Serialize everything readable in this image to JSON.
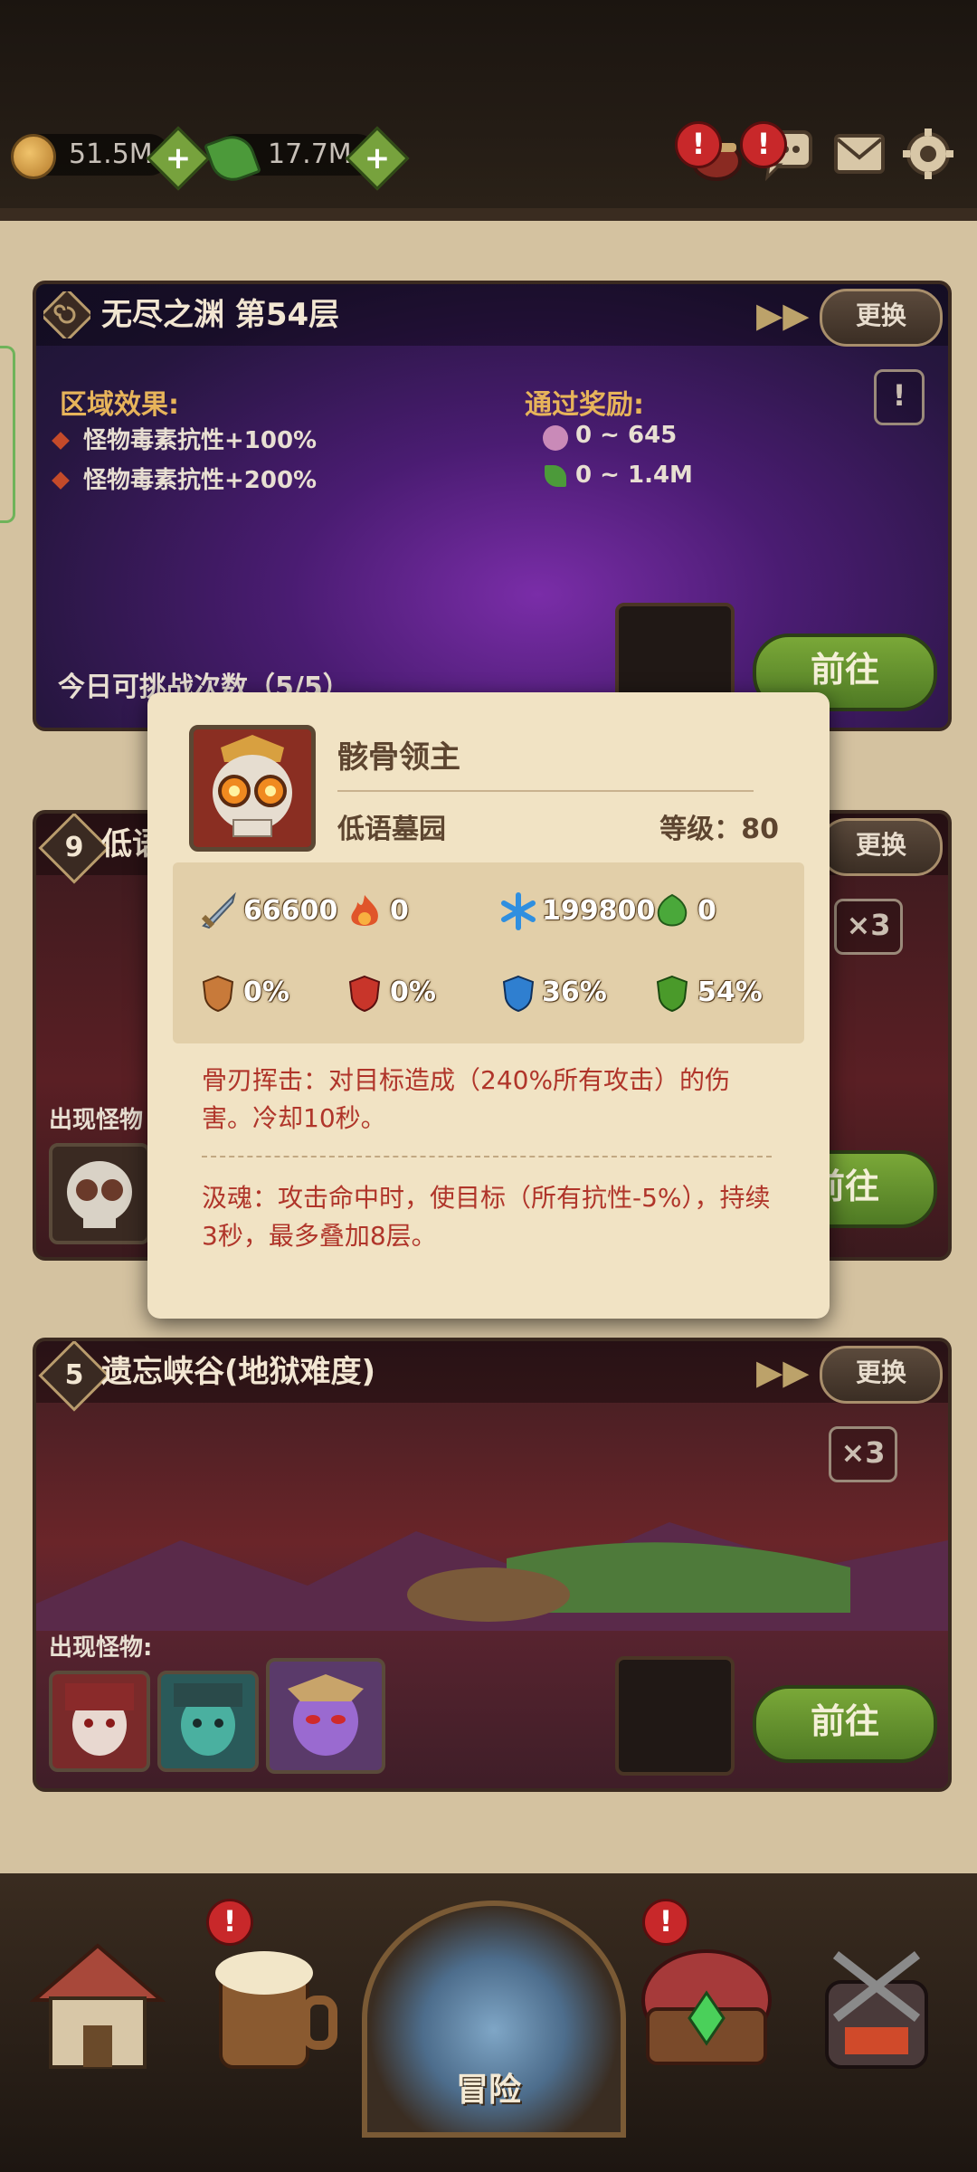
{
  "resources": {
    "coins": "51.5M",
    "leaves": "17.7M"
  },
  "top_icons": [
    "mail-icon",
    "chat-icon",
    "gear-icon",
    "pot-icon"
  ],
  "panels": [
    {
      "title": "无尽之渊 第54层",
      "swap_label": "更换",
      "area_effect_label": "区域效果:",
      "effects": [
        "怪物毒素抗性+100%",
        "怪物毒素抗性+200%"
      ],
      "reward_label": "通过奖励:",
      "rewards": [
        "0 ~ 645",
        "0 ~ 1.4M"
      ],
      "challenge_text": "今日可挑战次数（5/5）",
      "go_label": "前往"
    },
    {
      "number": "9",
      "title": "低语",
      "swap_label": "更换",
      "times": "×3",
      "monsters_label": "出现怪物",
      "go_label": "前往"
    },
    {
      "number": "5",
      "title": "遗忘峡谷(地狱难度)",
      "swap_label": "更换",
      "times": "×3",
      "monsters_label": "出现怪物:",
      "go_label": "前往"
    }
  ],
  "popup": {
    "name": "骸骨领主",
    "place": "低语墓园",
    "level": "等级：80",
    "stats": [
      {
        "icon": "sword-icon",
        "value": "66600",
        "color": "#8fa3b8"
      },
      {
        "icon": "fire-icon",
        "value": "0",
        "color": "#e0552a"
      },
      {
        "icon": "frost-icon",
        "value": "199800",
        "color": "#2f8fe0"
      },
      {
        "icon": "poison-icon",
        "value": "0",
        "color": "#4aa83a"
      },
      {
        "icon": "physical-shield-icon",
        "value": "0%",
        "color": "#c87a3a"
      },
      {
        "icon": "fire-shield-icon",
        "value": "0%",
        "color": "#c8352a"
      },
      {
        "icon": "frost-shield-icon",
        "value": "36%",
        "color": "#2f7fd0"
      },
      {
        "icon": "poison-shield-icon",
        "value": "54%",
        "color": "#4a9a2a"
      }
    ],
    "skill1": "骨刃挥击：对目标造成（240%所有攻击）的伤害。冷却10秒。",
    "skill2": "汲魂：攻击命中时，使目标（所有抗性-5%），持续3秒，最多叠加8层。"
  },
  "nav": {
    "center_label": "冒险",
    "items": [
      "house-icon",
      "tavern-icon",
      "adventure-icon",
      "treasure-icon",
      "forge-icon"
    ]
  }
}
